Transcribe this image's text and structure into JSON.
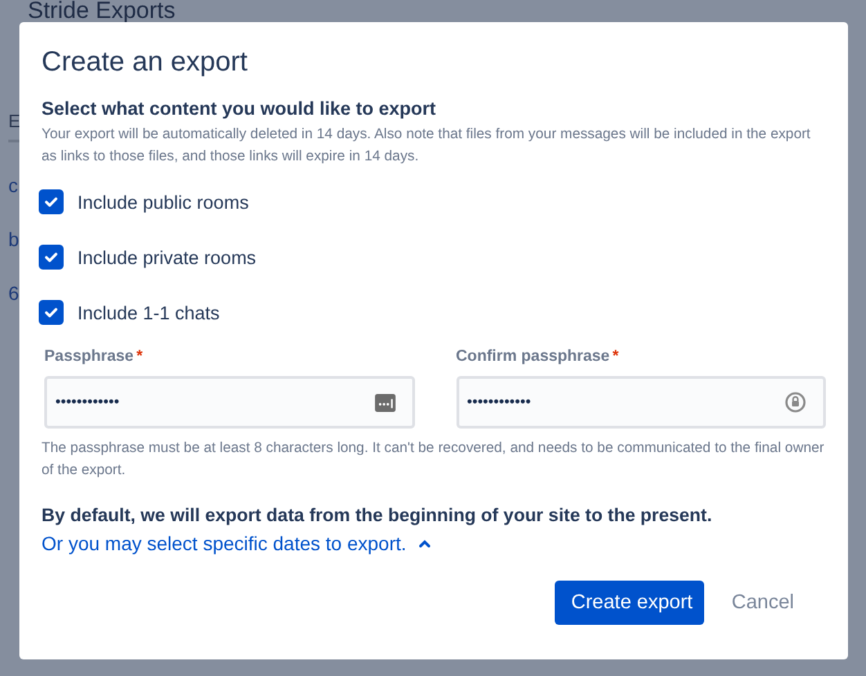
{
  "background_page": {
    "title": "Stride Exports",
    "column_header": "E",
    "rows": [
      "c",
      "b",
      "6"
    ]
  },
  "dialog": {
    "title": "Create an export",
    "section_heading": "Select what content you would like to export",
    "section_note": "Your export will be automatically deleted in 14 days. Also note that files from your messages will be included in the export as links to those files, and those links will expire in 14 days.",
    "options": [
      {
        "label": "Include public rooms",
        "checked": true
      },
      {
        "label": "Include private rooms",
        "checked": true
      },
      {
        "label": "Include 1-1 chats",
        "checked": true
      }
    ],
    "fields": [
      {
        "label": "Passphrase",
        "required_mark": "*",
        "value": "••••••••••••"
      },
      {
        "label": "Confirm passphrase",
        "required_mark": "*",
        "value": "••••••••••••"
      }
    ],
    "field_hint": "The passphrase must be at least 8 characters long. It can't be recovered, and needs to be communicated to the final owner of the export.",
    "date_note": "By default, we will export data from the beginning of your site to the present.",
    "date_link": {
      "text": "Or you may select specific dates to export.",
      "expanded": true
    },
    "buttons": [
      {
        "label": "Create export",
        "kind": "primary"
      },
      {
        "label": "Cancel",
        "kind": "subtle"
      }
    ]
  }
}
